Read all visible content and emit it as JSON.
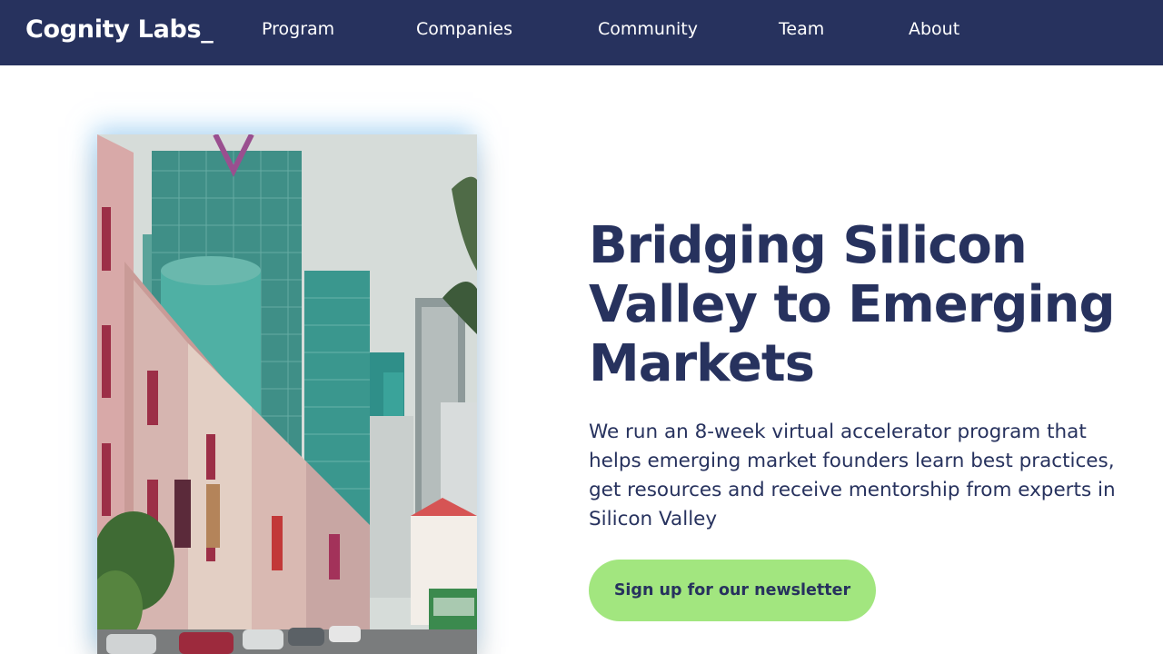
{
  "brand": {
    "logo_text": "Cognity Labs_"
  },
  "nav": {
    "items": [
      {
        "label": "Program"
      },
      {
        "label": "Companies"
      },
      {
        "label": "Community"
      },
      {
        "label": "Team"
      },
      {
        "label": "About"
      }
    ]
  },
  "hero": {
    "headline": "Bridging Silicon Valley to Emerging Markets",
    "description": "We run an 8-week virtual accelerator program that helps emerging market founders learn best practices, get resources and receive mentorship from experts in Silicon Valley",
    "cta_label": "Sign up for our newsletter"
  },
  "colors": {
    "navy": "#27325e",
    "accent_green": "#a2e67f",
    "background": "#ffffff"
  }
}
